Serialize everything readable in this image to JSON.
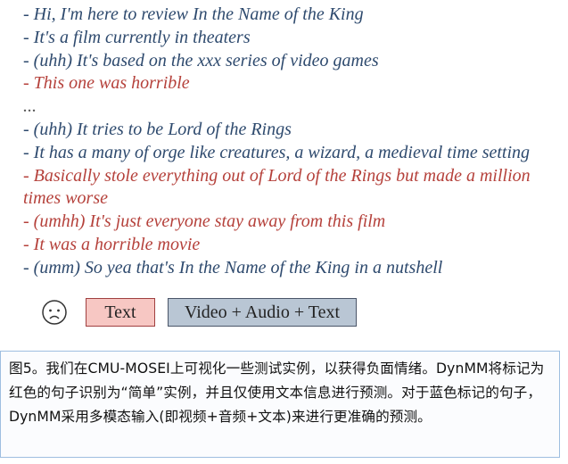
{
  "transcript": [
    {
      "text": "- Hi, I'm here to review In the Name of the King",
      "color": "blue"
    },
    {
      "text": "- It's a film currently in theaters",
      "color": "blue"
    },
    {
      "text": "- (uhh) It's based on the xxx series of video games",
      "color": "blue"
    },
    {
      "text": "- This one was horrible",
      "color": "red"
    },
    {
      "text": "...",
      "color": "gray"
    },
    {
      "text": "- (uhh) It tries to be Lord of the Rings",
      "color": "blue"
    },
    {
      "text": "- It has a many of orge like creatures, a wizard, a medieval time setting",
      "color": "blue"
    },
    {
      "text": "- Basically stole everything out of Lord of the Rings but made a million times worse",
      "color": "red"
    },
    {
      "text": "- (umhh) It's just everyone stay away from this film",
      "color": "red"
    },
    {
      "text": "- It was a horrible movie",
      "color": "red"
    },
    {
      "text": "- (umm) So yea that's In the Name of the King in a nutshell",
      "color": "blue"
    }
  ],
  "legend": {
    "face_icon": "sad-face-icon",
    "text_label": "Text",
    "multimodal_label": "Video + Audio + Text",
    "colors": {
      "text_fill": "#f7c7c3",
      "text_border": "#a04040",
      "multimodal_fill": "#b9c6d4",
      "multimodal_border": "#4a5568"
    }
  },
  "caption": {
    "text": "图5。我们在CMU-MOSEI上可视化一些测试实例，以获得负面情绪。DynMM将标记为红色的句子识别为“简单”实例，并且仅使用文本信息进行预测。对于蓝色标记的句子，DynMM采用多模态输入(即视频+音频+文本)来进行更准确的预测。"
  },
  "colors": {
    "blue_text": "#2e4a6e",
    "red_text": "#b5413b",
    "caption_border": "#9ebee0"
  }
}
